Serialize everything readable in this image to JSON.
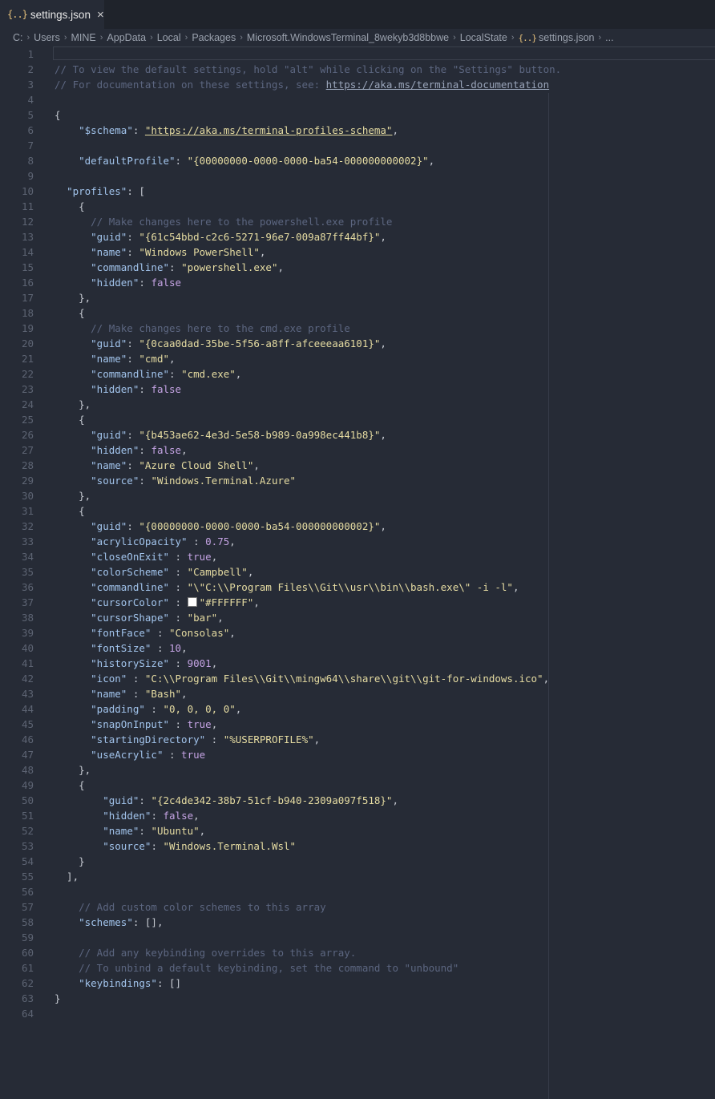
{
  "tab": {
    "icon": "{..}",
    "label": "settings.json",
    "close": "×"
  },
  "breadcrumb": [
    "C:",
    "Users",
    "MINE",
    "AppData",
    "Local",
    "Packages",
    "Microsoft.WindowsTerminal_8wekyb3d8bbwe",
    "LocalState",
    "settings.json",
    "..."
  ],
  "breadcrumb_file_icon": "{..}",
  "lines": [
    [],
    [
      [
        "com",
        "// To view the default settings, hold \"alt\" while clicking on the \"Settings\" button."
      ]
    ],
    [
      [
        "com",
        "// For documentation on these settings, see: "
      ],
      [
        "lk2",
        "https://aka.ms/terminal-documentation"
      ]
    ],
    [],
    [
      [
        "pun",
        "{"
      ]
    ],
    [
      [
        "pun",
        "    "
      ],
      [
        "key",
        "\"$schema\""
      ],
      [
        "pun",
        ": "
      ],
      [
        "link",
        "\"https://aka.ms/terminal-profiles-schema\""
      ],
      [
        "pun",
        ","
      ]
    ],
    [],
    [
      [
        "pun",
        "    "
      ],
      [
        "key",
        "\"defaultProfile\""
      ],
      [
        "pun",
        ": "
      ],
      [
        "str",
        "\"{00000000-0000-0000-ba54-000000000002}\""
      ],
      [
        "pun",
        ","
      ]
    ],
    [],
    [
      [
        "pun",
        "  "
      ],
      [
        "key",
        "\"profiles\""
      ],
      [
        "pun",
        ": ["
      ]
    ],
    [
      [
        "pun",
        "    {"
      ]
    ],
    [
      [
        "pun",
        "      "
      ],
      [
        "com",
        "// Make changes here to the powershell.exe profile"
      ]
    ],
    [
      [
        "pun",
        "      "
      ],
      [
        "key",
        "\"guid\""
      ],
      [
        "pun",
        ": "
      ],
      [
        "str",
        "\"{61c54bbd-c2c6-5271-96e7-009a87ff44bf}\""
      ],
      [
        "pun",
        ","
      ]
    ],
    [
      [
        "pun",
        "      "
      ],
      [
        "key",
        "\"name\""
      ],
      [
        "pun",
        ": "
      ],
      [
        "str",
        "\"Windows PowerShell\""
      ],
      [
        "pun",
        ","
      ]
    ],
    [
      [
        "pun",
        "      "
      ],
      [
        "key",
        "\"commandline\""
      ],
      [
        "pun",
        ": "
      ],
      [
        "str",
        "\"powershell.exe\""
      ],
      [
        "pun",
        ","
      ]
    ],
    [
      [
        "pun",
        "      "
      ],
      [
        "key",
        "\"hidden\""
      ],
      [
        "pun",
        ": "
      ],
      [
        "num",
        "false"
      ]
    ],
    [
      [
        "pun",
        "    },"
      ]
    ],
    [
      [
        "pun",
        "    {"
      ]
    ],
    [
      [
        "pun",
        "      "
      ],
      [
        "com",
        "// Make changes here to the cmd.exe profile"
      ]
    ],
    [
      [
        "pun",
        "      "
      ],
      [
        "key",
        "\"guid\""
      ],
      [
        "pun",
        ": "
      ],
      [
        "str",
        "\"{0caa0dad-35be-5f56-a8ff-afceeeaa6101}\""
      ],
      [
        "pun",
        ","
      ]
    ],
    [
      [
        "pun",
        "      "
      ],
      [
        "key",
        "\"name\""
      ],
      [
        "pun",
        ": "
      ],
      [
        "str",
        "\"cmd\""
      ],
      [
        "pun",
        ","
      ]
    ],
    [
      [
        "pun",
        "      "
      ],
      [
        "key",
        "\"commandline\""
      ],
      [
        "pun",
        ": "
      ],
      [
        "str",
        "\"cmd.exe\""
      ],
      [
        "pun",
        ","
      ]
    ],
    [
      [
        "pun",
        "      "
      ],
      [
        "key",
        "\"hidden\""
      ],
      [
        "pun",
        ": "
      ],
      [
        "num",
        "false"
      ]
    ],
    [
      [
        "pun",
        "    },"
      ]
    ],
    [
      [
        "pun",
        "    {"
      ]
    ],
    [
      [
        "pun",
        "      "
      ],
      [
        "key",
        "\"guid\""
      ],
      [
        "pun",
        ": "
      ],
      [
        "str",
        "\"{b453ae62-4e3d-5e58-b989-0a998ec441b8}\""
      ],
      [
        "pun",
        ","
      ]
    ],
    [
      [
        "pun",
        "      "
      ],
      [
        "key",
        "\"hidden\""
      ],
      [
        "pun",
        ": "
      ],
      [
        "num",
        "false"
      ],
      [
        "pun",
        ","
      ]
    ],
    [
      [
        "pun",
        "      "
      ],
      [
        "key",
        "\"name\""
      ],
      [
        "pun",
        ": "
      ],
      [
        "str",
        "\"Azure Cloud Shell\""
      ],
      [
        "pun",
        ","
      ]
    ],
    [
      [
        "pun",
        "      "
      ],
      [
        "key",
        "\"source\""
      ],
      [
        "pun",
        ": "
      ],
      [
        "str",
        "\"Windows.Terminal.Azure\""
      ]
    ],
    [
      [
        "pun",
        "    },"
      ]
    ],
    [
      [
        "pun",
        "    {"
      ]
    ],
    [
      [
        "pun",
        "      "
      ],
      [
        "key",
        "\"guid\""
      ],
      [
        "pun",
        ": "
      ],
      [
        "str",
        "\"{00000000-0000-0000-ba54-000000000002}\""
      ],
      [
        "pun",
        ","
      ]
    ],
    [
      [
        "pun",
        "      "
      ],
      [
        "key",
        "\"acrylicOpacity\""
      ],
      [
        "pun",
        " : "
      ],
      [
        "num",
        "0.75"
      ],
      [
        "pun",
        ","
      ]
    ],
    [
      [
        "pun",
        "      "
      ],
      [
        "key",
        "\"closeOnExit\""
      ],
      [
        "pun",
        " : "
      ],
      [
        "num",
        "true"
      ],
      [
        "pun",
        ","
      ]
    ],
    [
      [
        "pun",
        "      "
      ],
      [
        "key",
        "\"colorScheme\""
      ],
      [
        "pun",
        " : "
      ],
      [
        "str",
        "\"Campbell\""
      ],
      [
        "pun",
        ","
      ]
    ],
    [
      [
        "pun",
        "      "
      ],
      [
        "key",
        "\"commandline\""
      ],
      [
        "pun",
        " : "
      ],
      [
        "str",
        "\"\\\"C:\\\\Program Files\\\\Git\\\\usr\\\\bin\\\\bash.exe\\\" -i -l\""
      ],
      [
        "pun",
        ","
      ]
    ],
    [
      [
        "pun",
        "      "
      ],
      [
        "key",
        "\"cursorColor\""
      ],
      [
        "pun",
        " : "
      ],
      [
        "swatch",
        ""
      ],
      [
        "str",
        "\"#FFFFFF\""
      ],
      [
        "pun",
        ","
      ]
    ],
    [
      [
        "pun",
        "      "
      ],
      [
        "key",
        "\"cursorShape\""
      ],
      [
        "pun",
        " : "
      ],
      [
        "str",
        "\"bar\""
      ],
      [
        "pun",
        ","
      ]
    ],
    [
      [
        "pun",
        "      "
      ],
      [
        "key",
        "\"fontFace\""
      ],
      [
        "pun",
        " : "
      ],
      [
        "str",
        "\"Consolas\""
      ],
      [
        "pun",
        ","
      ]
    ],
    [
      [
        "pun",
        "      "
      ],
      [
        "key",
        "\"fontSize\""
      ],
      [
        "pun",
        " : "
      ],
      [
        "num",
        "10"
      ],
      [
        "pun",
        ","
      ]
    ],
    [
      [
        "pun",
        "      "
      ],
      [
        "key",
        "\"historySize\""
      ],
      [
        "pun",
        " : "
      ],
      [
        "num",
        "9001"
      ],
      [
        "pun",
        ","
      ]
    ],
    [
      [
        "pun",
        "      "
      ],
      [
        "key",
        "\"icon\""
      ],
      [
        "pun",
        " : "
      ],
      [
        "str",
        "\"C:\\\\Program Files\\\\Git\\\\mingw64\\\\share\\\\git\\\\git-for-windows.ico\""
      ],
      [
        "pun",
        ","
      ]
    ],
    [
      [
        "pun",
        "      "
      ],
      [
        "key",
        "\"name\""
      ],
      [
        "pun",
        " : "
      ],
      [
        "str",
        "\"Bash\""
      ],
      [
        "pun",
        ","
      ]
    ],
    [
      [
        "pun",
        "      "
      ],
      [
        "key",
        "\"padding\""
      ],
      [
        "pun",
        " : "
      ],
      [
        "str",
        "\"0, 0, 0, 0\""
      ],
      [
        "pun",
        ","
      ]
    ],
    [
      [
        "pun",
        "      "
      ],
      [
        "key",
        "\"snapOnInput\""
      ],
      [
        "pun",
        " : "
      ],
      [
        "num",
        "true"
      ],
      [
        "pun",
        ","
      ]
    ],
    [
      [
        "pun",
        "      "
      ],
      [
        "key",
        "\"startingDirectory\""
      ],
      [
        "pun",
        " : "
      ],
      [
        "str",
        "\"%USERPROFILE%\""
      ],
      [
        "pun",
        ","
      ]
    ],
    [
      [
        "pun",
        "      "
      ],
      [
        "key",
        "\"useAcrylic\""
      ],
      [
        "pun",
        " : "
      ],
      [
        "num",
        "true"
      ]
    ],
    [
      [
        "pun",
        "    },"
      ]
    ],
    [
      [
        "pun",
        "    {"
      ]
    ],
    [
      [
        "pun",
        "        "
      ],
      [
        "key",
        "\"guid\""
      ],
      [
        "pun",
        ": "
      ],
      [
        "str",
        "\"{2c4de342-38b7-51cf-b940-2309a097f518}\""
      ],
      [
        "pun",
        ","
      ]
    ],
    [
      [
        "pun",
        "        "
      ],
      [
        "key",
        "\"hidden\""
      ],
      [
        "pun",
        ": "
      ],
      [
        "num",
        "false"
      ],
      [
        "pun",
        ","
      ]
    ],
    [
      [
        "pun",
        "        "
      ],
      [
        "key",
        "\"name\""
      ],
      [
        "pun",
        ": "
      ],
      [
        "str",
        "\"Ubuntu\""
      ],
      [
        "pun",
        ","
      ]
    ],
    [
      [
        "pun",
        "        "
      ],
      [
        "key",
        "\"source\""
      ],
      [
        "pun",
        ": "
      ],
      [
        "str",
        "\"Windows.Terminal.Wsl\""
      ]
    ],
    [
      [
        "pun",
        "    }"
      ]
    ],
    [
      [
        "pun",
        "  ],"
      ]
    ],
    [],
    [
      [
        "pun",
        "    "
      ],
      [
        "com",
        "// Add custom color schemes to this array"
      ]
    ],
    [
      [
        "pun",
        "    "
      ],
      [
        "key",
        "\"schemes\""
      ],
      [
        "pun",
        ": [],"
      ]
    ],
    [],
    [
      [
        "pun",
        "    "
      ],
      [
        "com",
        "// Add any keybinding overrides to this array."
      ]
    ],
    [
      [
        "pun",
        "    "
      ],
      [
        "com",
        "// To unbind a default keybinding, set the command to \"unbound\""
      ]
    ],
    [
      [
        "pun",
        "    "
      ],
      [
        "key",
        "\"keybindings\""
      ],
      [
        "pun",
        ": []"
      ]
    ],
    [
      [
        "pun",
        "}"
      ]
    ],
    []
  ]
}
